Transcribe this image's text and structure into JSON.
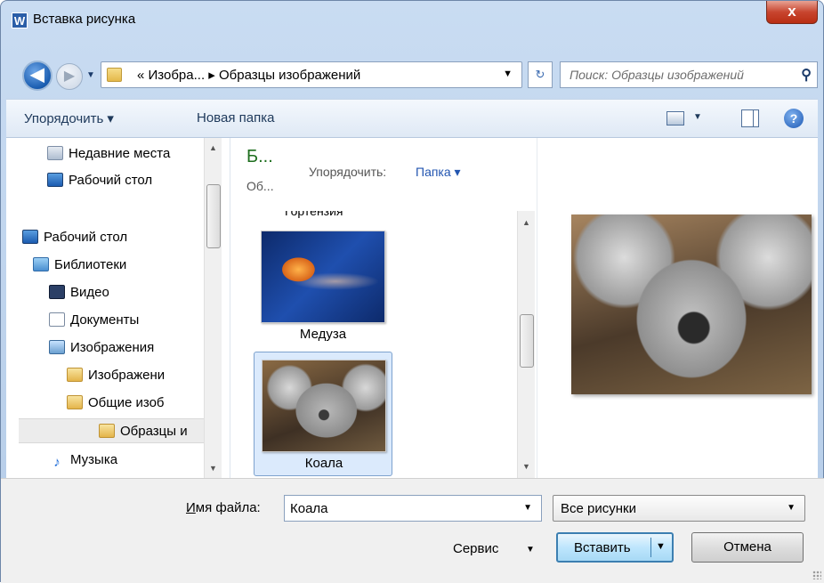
{
  "window": {
    "icon_letter": "W",
    "title": "Вставка рисунка",
    "close_glyph": "x"
  },
  "nav": {
    "address": {
      "crumbs": "«  Изобра...  ▸  Образцы изображений"
    },
    "search": {
      "placeholder": "Поиск: Образцы изображений"
    }
  },
  "toolbar": {
    "organize": "Упорядочить ▾",
    "new_folder": "Новая папка",
    "help": "?"
  },
  "sidebar": {
    "items": [
      {
        "label": "Недавние места",
        "icon": "recent-places-icon"
      },
      {
        "label": "Рабочий стол",
        "icon": "desktop-icon"
      },
      {
        "label": "Рабочий стол",
        "icon": "desktop-icon"
      },
      {
        "label": "Библиотеки",
        "icon": "libraries-icon"
      },
      {
        "label": "Видео",
        "icon": "video-icon"
      },
      {
        "label": "Документы",
        "icon": "documents-icon"
      },
      {
        "label": "Изображения",
        "icon": "pictures-icon"
      },
      {
        "label": "Изображени",
        "icon": "pictures-folder-icon"
      },
      {
        "label": "Общие изоб",
        "icon": "folder-icon"
      },
      {
        "label": "Образцы и",
        "icon": "folder-icon"
      },
      {
        "label": "Музыка",
        "icon": "music-icon"
      }
    ]
  },
  "library": {
    "title": "Б...",
    "subtitle": "Об...",
    "arrange_label": "Упорядочить:",
    "arrange_value": "Папка ▾"
  },
  "files": {
    "partial_label": "Гортензия",
    "items": [
      {
        "label": "Медуза",
        "thumb": "jellyfish"
      },
      {
        "label": "Коала",
        "thumb": "koala"
      }
    ]
  },
  "footer": {
    "filename_label_u": "И",
    "filename_label_rest": "мя файла:",
    "filename_value": "Коала",
    "filter_value": "Все рисунки",
    "tools_label": "Сервис",
    "insert_label": "Вставить",
    "cancel_label": "Отмена"
  }
}
